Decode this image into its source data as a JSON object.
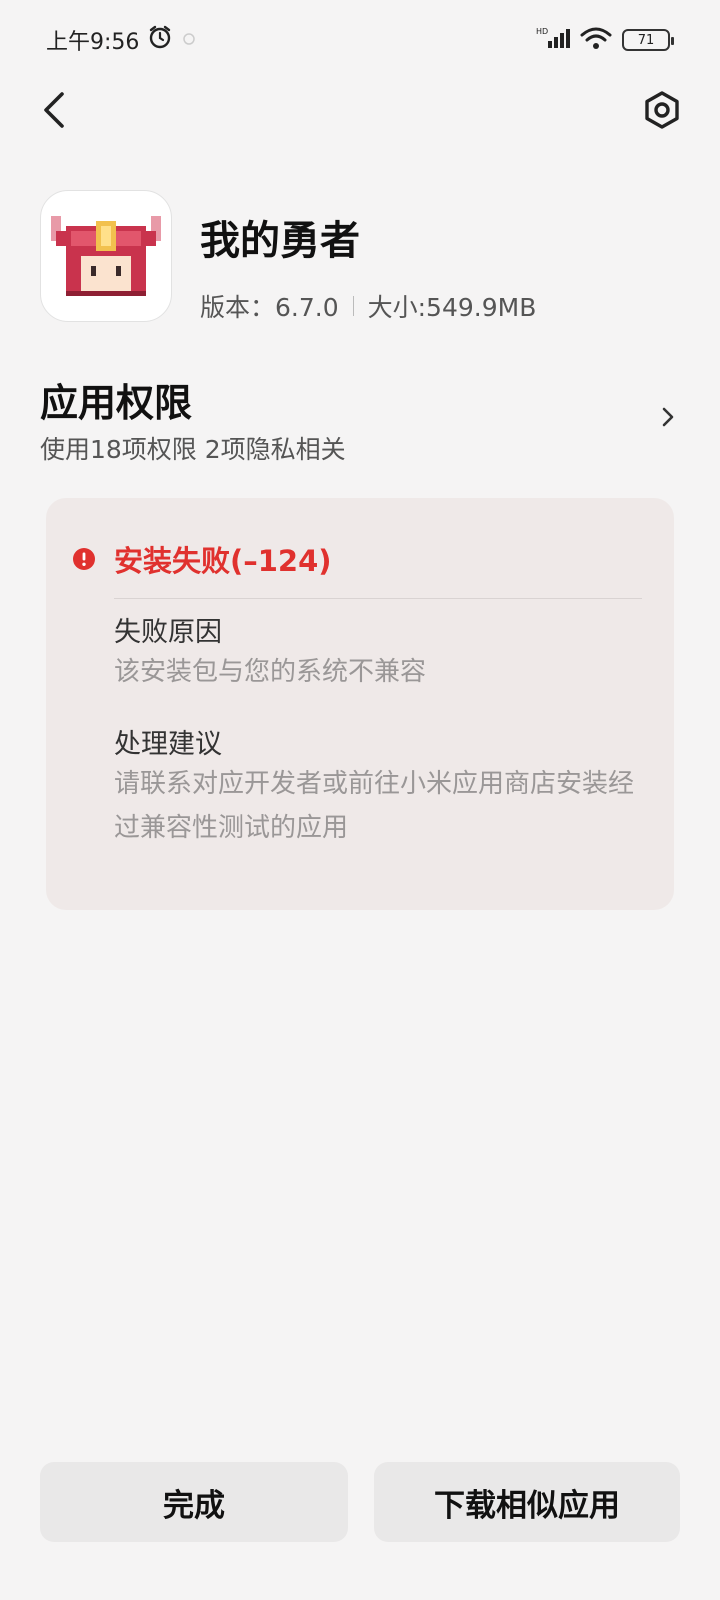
{
  "status_bar": {
    "time": "上午9:56",
    "battery": "71",
    "network": "HD"
  },
  "app": {
    "name": "我的勇者",
    "version": "版本：6.7.0",
    "size": "大小:549.9MB"
  },
  "permissions": {
    "title": "应用权限",
    "summary": "使用18项权限  2项隐私相关"
  },
  "error": {
    "title": "安装失败(–124)",
    "reason_label": "失败原因",
    "reason_text": "该安装包与您的系统不兼容",
    "suggestion_label": "处理建议",
    "suggestion_text": "请联系对应开发者或前往小米应用商店安装经过兼容性测试的应用",
    "color": "#e0312e"
  },
  "buttons": {
    "done": "完成",
    "similar": "下载相似应用"
  }
}
